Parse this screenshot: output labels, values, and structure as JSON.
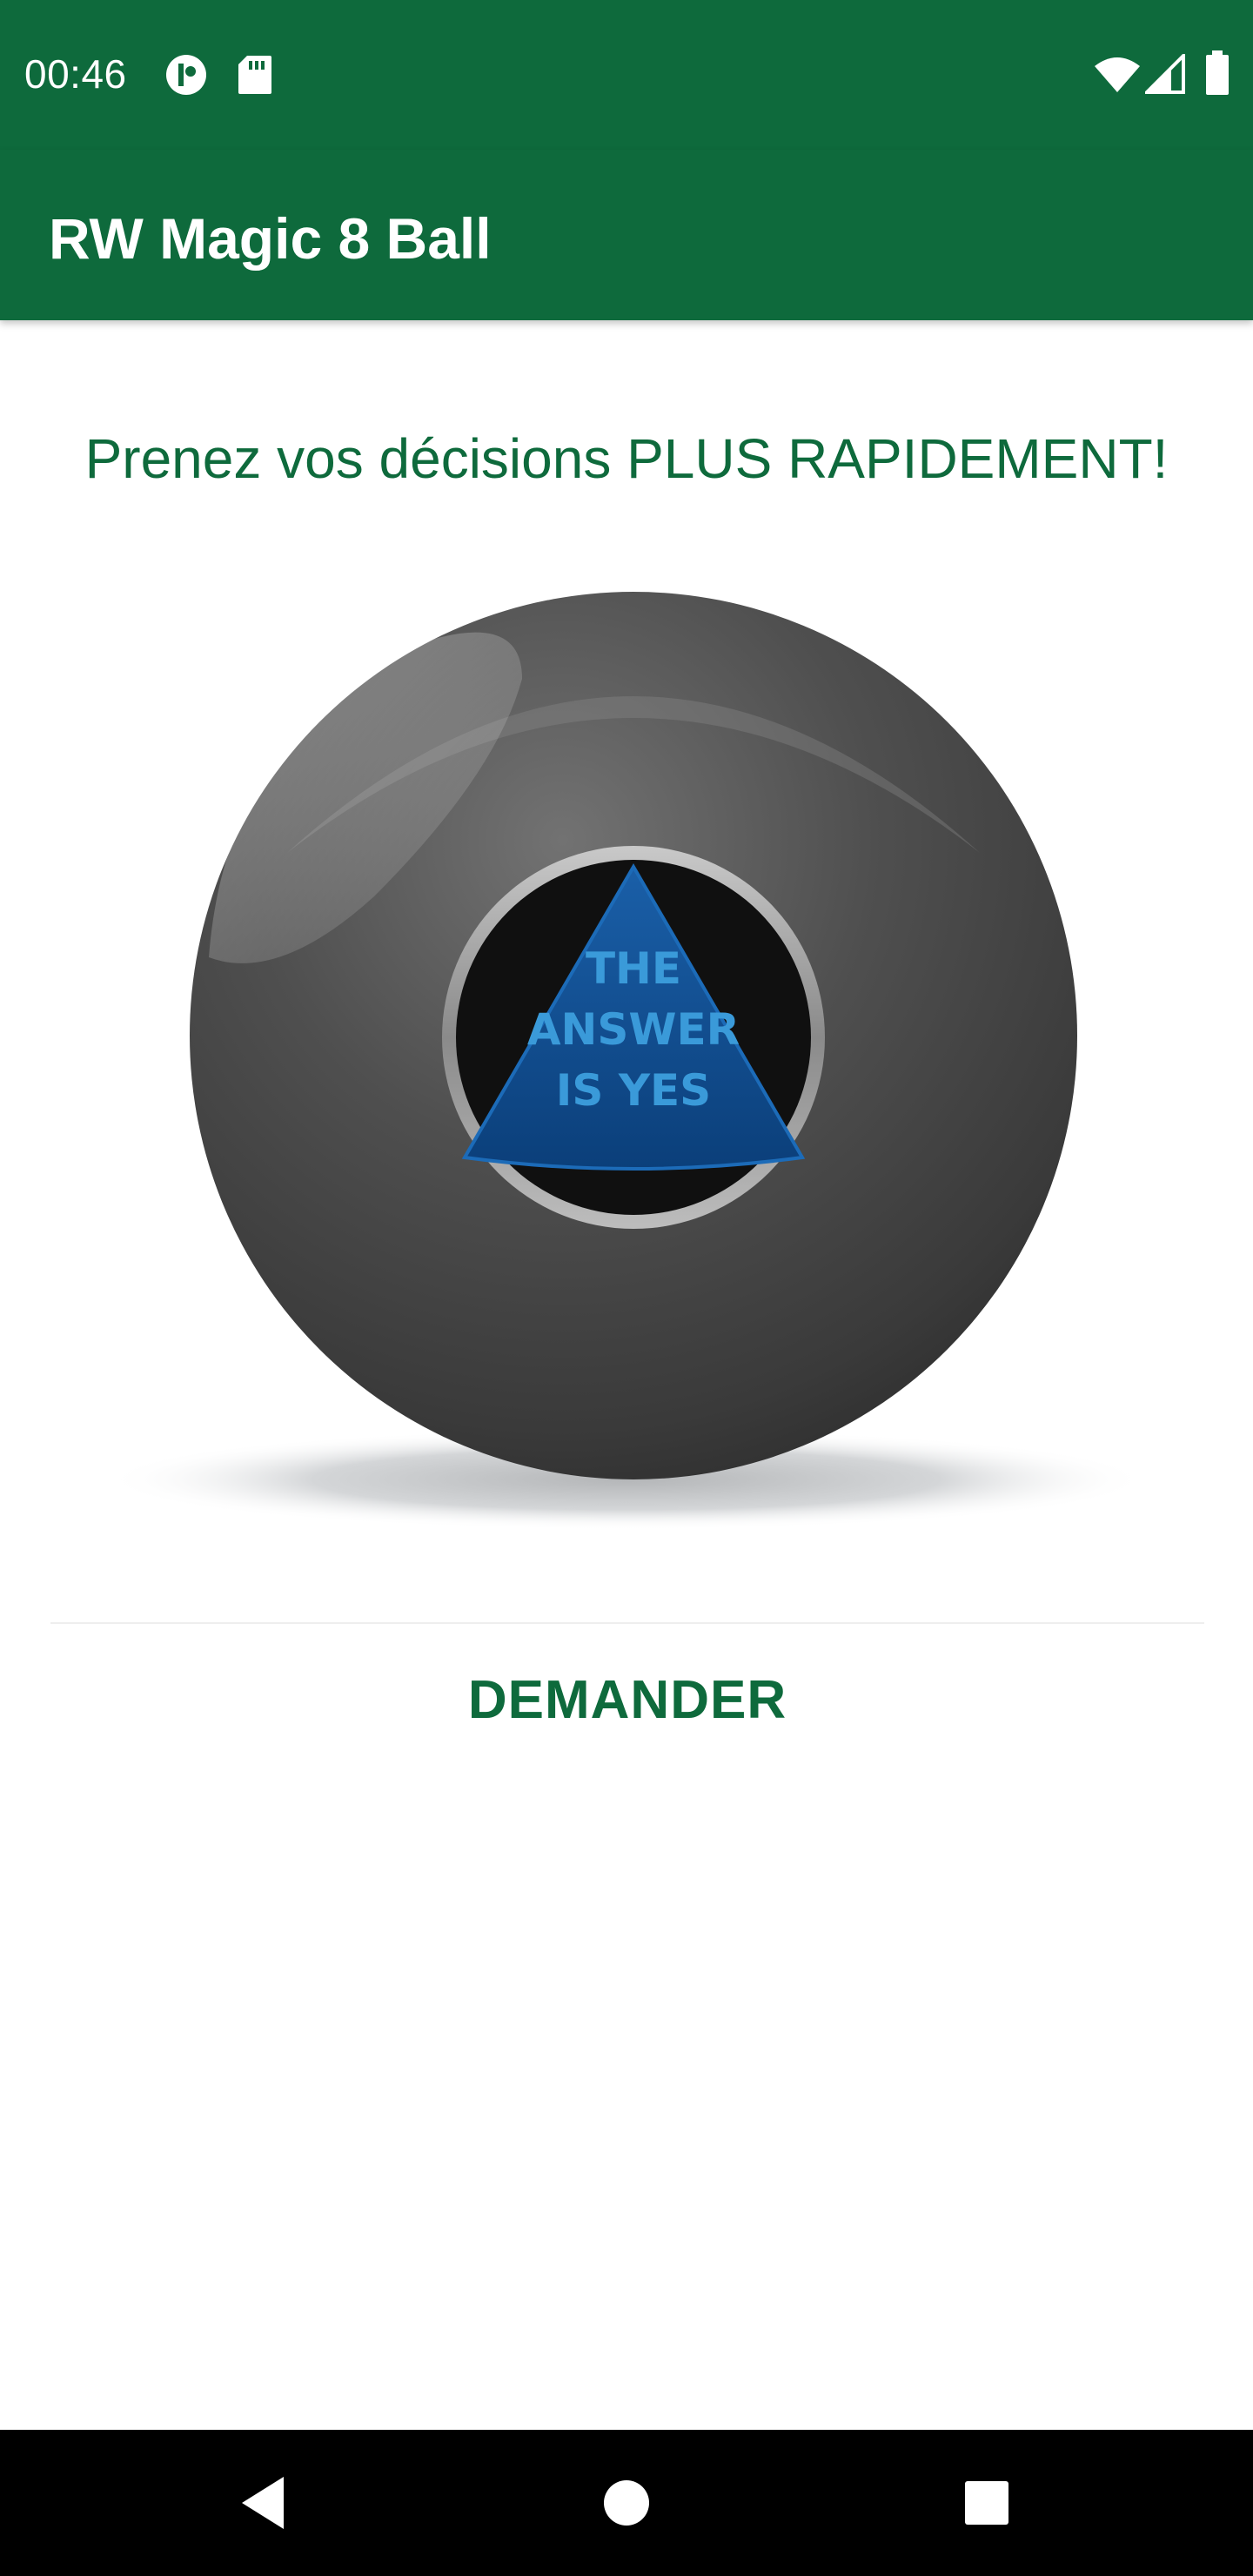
{
  "status_bar": {
    "time": "00:46",
    "background_color": "#0e6a3c",
    "icons_left": [
      "data-saver-icon",
      "sd-card-icon"
    ],
    "icons_right": [
      "wifi-icon",
      "cell-signal-icon",
      "battery-icon"
    ]
  },
  "app_bar": {
    "title": "RW Magic 8 Ball",
    "background_color": "#0e6a3c"
  },
  "main": {
    "tagline": "Prenez vos décisions PLUS RAPIDEMENT!",
    "ball": {
      "answer_lines": [
        "THE",
        "ANSWER",
        "IS YES"
      ]
    },
    "ask_button_label": "DEMANDER",
    "accent_color": "#0e6a3c"
  },
  "nav_bar": {
    "buttons": [
      "back-icon",
      "home-icon",
      "recents-icon"
    ]
  }
}
